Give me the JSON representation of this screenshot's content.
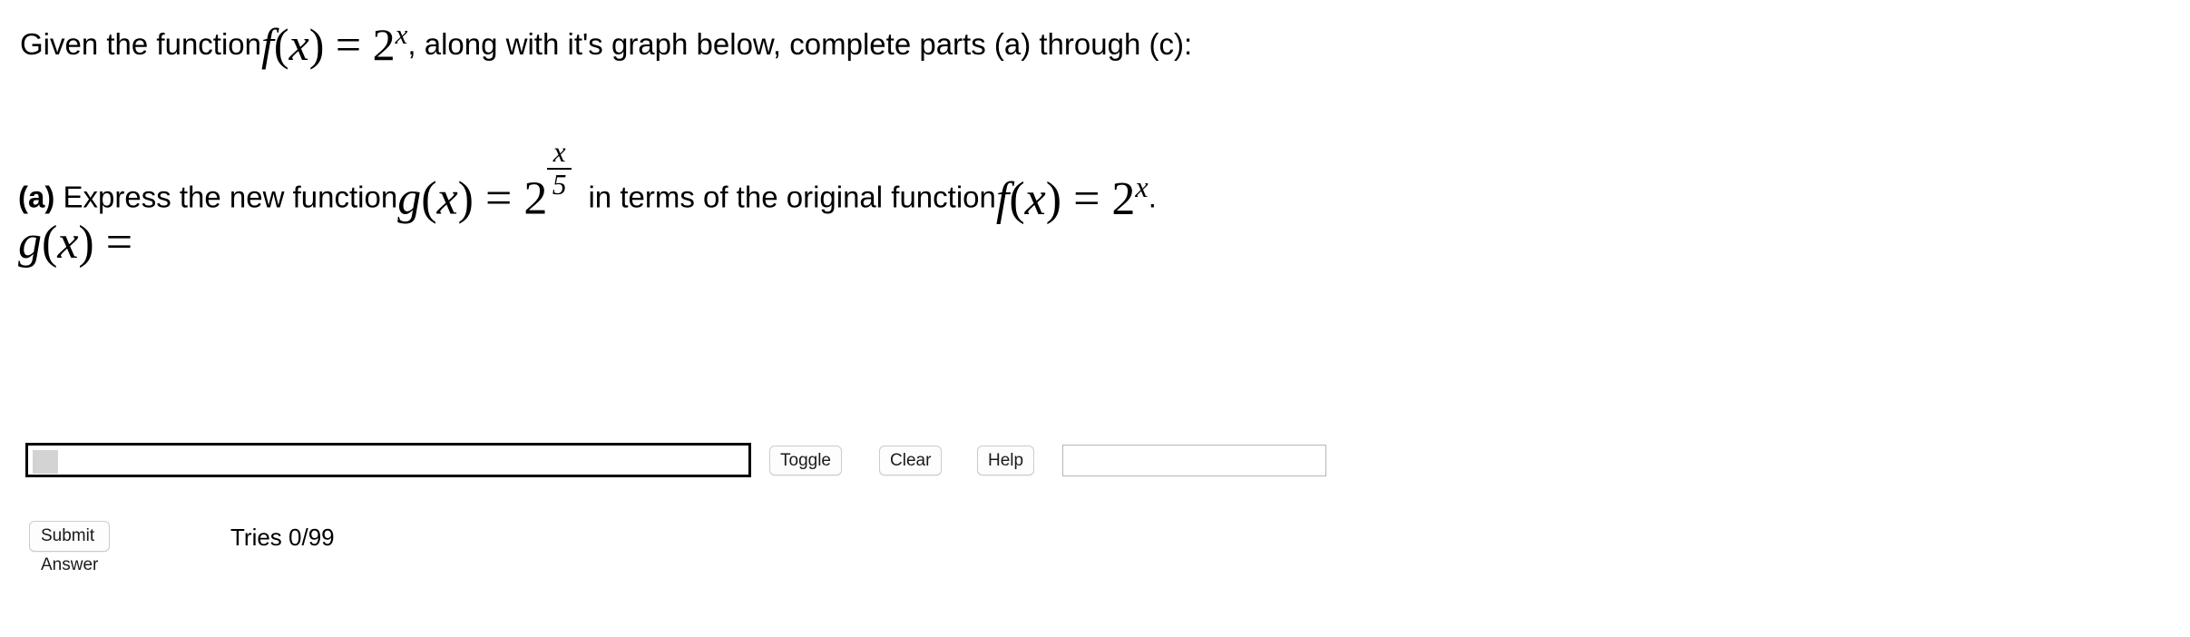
{
  "question": {
    "line1": {
      "text_before": "Given the function",
      "formula": {
        "lhs_fn": "f",
        "lhs_var": "x",
        "equals": "=",
        "base": "2",
        "exponent": "x"
      },
      "text_after": ", along with it's graph below, complete parts (a) through (c):"
    },
    "part_a": {
      "label": "(a)",
      "text_before": "Express the new function",
      "formula_g": {
        "lhs_fn": "g",
        "lhs_var": "x",
        "equals": "=",
        "base": "2",
        "exponent_numerator": "x",
        "exponent_denominator": "5"
      },
      "text_middle": "in terms of the original function",
      "formula_f": {
        "lhs_fn": "f",
        "lhs_var": "x",
        "equals": "=",
        "base": "2",
        "exponent": "x"
      },
      "text_after": "."
    },
    "answer_prompt": {
      "lhs_fn": "g",
      "lhs_var": "x",
      "equals": "="
    }
  },
  "answer_area": {
    "math_input": {
      "value": "",
      "placeholder": ""
    },
    "buttons": [
      {
        "id": "toggle",
        "label": "Toggle"
      },
      {
        "id": "clear",
        "label": "Clear"
      },
      {
        "id": "help",
        "label": "Help"
      }
    ],
    "preview_field": {
      "value": "",
      "placeholder": ""
    }
  },
  "submit_area": {
    "submit_label": "Submit Answer",
    "tries_label": "Tries 0/99"
  },
  "colors": {
    "page_background": "#ffffff",
    "text": "#000000",
    "math_input_border": "#000000",
    "caret_block": "#d3d3d3",
    "button_border": "#cccccc",
    "button_background": "#fdfdfd",
    "preview_border": "#b4b4b4"
  }
}
